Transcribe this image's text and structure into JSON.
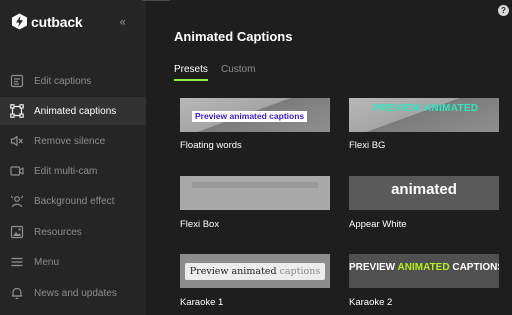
{
  "app": {
    "brand": "cutback",
    "collapse_glyph": "«",
    "help_glyph": "?"
  },
  "sidebar": {
    "items": [
      {
        "label": "Edit captions",
        "icon": "edit-captions-icon",
        "active": false
      },
      {
        "label": "Animated captions",
        "icon": "animated-captions-icon",
        "active": true
      },
      {
        "label": "Remove silence",
        "icon": "remove-silence-icon",
        "active": false
      },
      {
        "label": "Edit multi-cam",
        "icon": "multi-cam-icon",
        "active": false
      },
      {
        "label": "Background effect",
        "icon": "background-effect-icon",
        "active": false
      },
      {
        "label": "Resources",
        "icon": "resources-icon",
        "active": false
      },
      {
        "label": "Menu",
        "icon": "menu-icon",
        "active": false
      },
      {
        "label": "News and updates",
        "icon": "bell-icon",
        "active": false
      }
    ]
  },
  "main": {
    "title": "Animated Captions",
    "tabs": [
      {
        "label": "Presets",
        "active": true
      },
      {
        "label": "Custom",
        "active": false
      }
    ],
    "presets": [
      {
        "name": "Floating words",
        "preview": "Preview animated captions"
      },
      {
        "name": "Flexi BG",
        "preview": "PREVIEW ANIMATED"
      },
      {
        "name": "Flexi Box",
        "preview": ""
      },
      {
        "name": "Appear White",
        "preview": "animated"
      },
      {
        "name": "Karaoke 1",
        "preview_dark": "Preview animated ",
        "preview_light": "captions"
      },
      {
        "name": "Karaoke 2",
        "preview_a": "PREVIEW ",
        "preview_b": "ANIMATED",
        "preview_c": " CAPTIONS"
      }
    ]
  },
  "colors": {
    "accent": "#8ef04a",
    "sidebar_bg": "#252525",
    "main_bg": "#1e1e1e",
    "active_bg": "#323232"
  }
}
